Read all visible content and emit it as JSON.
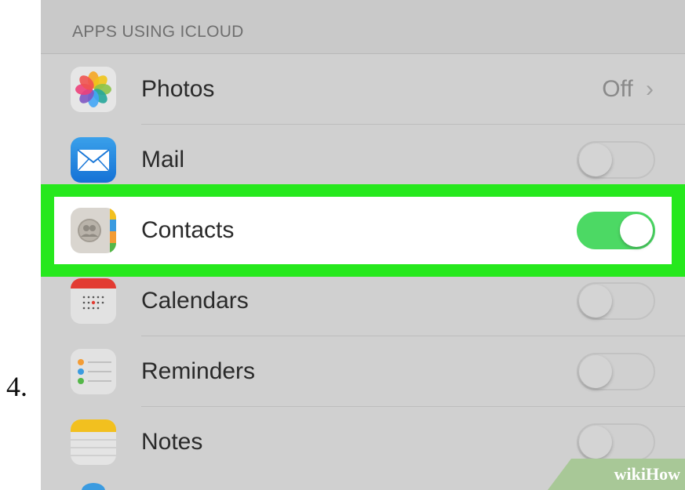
{
  "step_number": "4.",
  "section_header": "APPS USING ICLOUD",
  "rows": [
    {
      "name": "photos",
      "label": "Photos",
      "value": "Off",
      "icon": "photos-icon"
    },
    {
      "name": "mail",
      "label": "Mail",
      "toggle": "off",
      "icon": "mail-icon"
    },
    {
      "name": "contacts",
      "label": "Contacts",
      "toggle": "on",
      "icon": "contacts-icon"
    },
    {
      "name": "calendars",
      "label": "Calendars",
      "toggle": "off",
      "icon": "calendar-icon"
    },
    {
      "name": "reminders",
      "label": "Reminders",
      "toggle": "off",
      "icon": "reminders-icon"
    },
    {
      "name": "notes",
      "label": "Notes",
      "toggle": "off",
      "icon": "notes-icon"
    }
  ],
  "highlight_color": "#26e81d",
  "toggle_on_color": "#4cd964",
  "watermark": "wikiHow"
}
